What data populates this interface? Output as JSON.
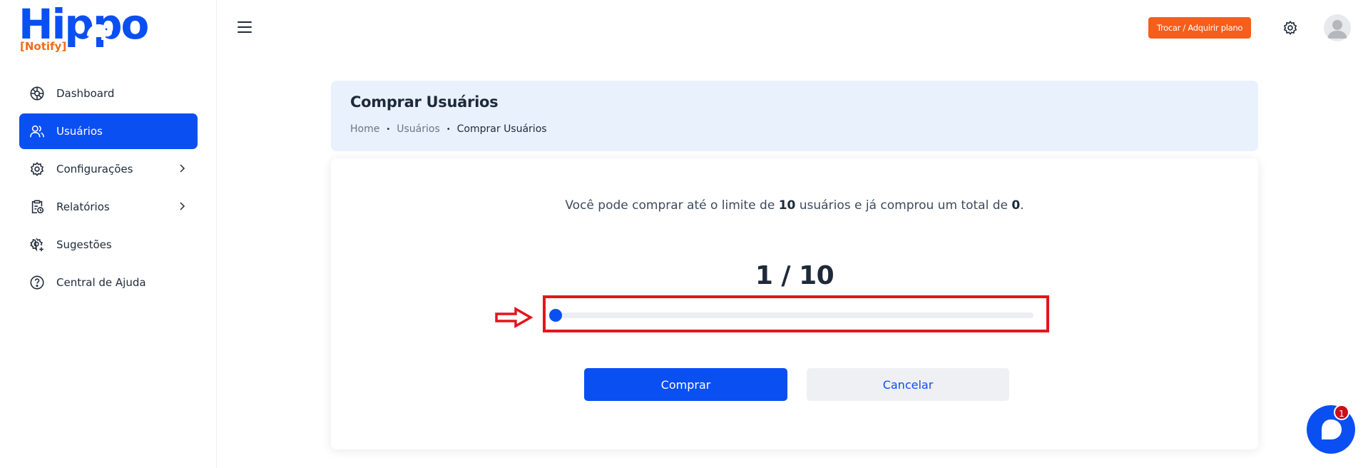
{
  "brand": {
    "name": "Hippo",
    "sub": "[Notify]"
  },
  "sidebar": {
    "items": [
      {
        "label": "Dashboard",
        "icon": "dashboard-icon",
        "active": false,
        "has_submenu": false
      },
      {
        "label": "Usuários",
        "icon": "users-icon",
        "active": true,
        "has_submenu": false
      },
      {
        "label": "Configurações",
        "icon": "gear-icon",
        "active": false,
        "has_submenu": true
      },
      {
        "label": "Relatórios",
        "icon": "report-icon",
        "active": false,
        "has_submenu": true
      },
      {
        "label": "Sugestões",
        "icon": "suggestion-icon",
        "active": false,
        "has_submenu": false
      },
      {
        "label": "Central de Ajuda",
        "icon": "help-icon",
        "active": false,
        "has_submenu": false
      }
    ]
  },
  "header": {
    "plan_button": "Trocar / Adquirir plano",
    "settings_icon": "gear-icon",
    "avatar_icon": "user-avatar-icon"
  },
  "page": {
    "title": "Comprar Usuários",
    "breadcrumb": [
      "Home",
      "Usuários",
      "Comprar Usuários"
    ]
  },
  "purchase": {
    "info_prefix": "Você pode comprar até o limite de ",
    "limit": "10",
    "info_middle": " usuários e já comprou um total de ",
    "purchased": "0",
    "info_suffix": ".",
    "counter": "1 / 10",
    "slider_value": 1,
    "slider_min": 1,
    "slider_max": 10,
    "buy_label": "Comprar",
    "cancel_label": "Cancelar"
  },
  "chat": {
    "badge": "1"
  },
  "colors": {
    "primary": "#0a4ff2",
    "accent_orange": "#f55e1d",
    "highlight_red": "#e5141c",
    "title_bg": "#e9f1fd"
  }
}
